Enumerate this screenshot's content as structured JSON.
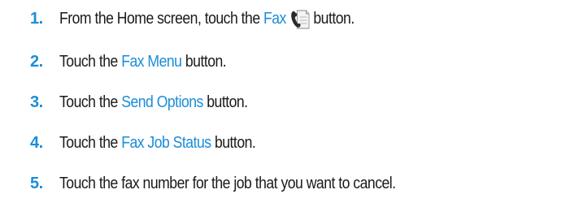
{
  "accent_color": "#1a8dd8",
  "steps": [
    {
      "number": "1.",
      "number_color": "#1a8dd8",
      "before": "From the Home screen, touch the",
      "link": "Fax",
      "icon": "fax-phone-icon",
      "after": "button."
    },
    {
      "number": "2.",
      "number_color": "#1a8dd8",
      "before": "Touch the",
      "link": "Fax Menu",
      "after": "button."
    },
    {
      "number": "3.",
      "number_color": "#1a8dd8",
      "before": "Touch the",
      "link": "Send Options",
      "after": "button."
    },
    {
      "number": "4.",
      "number_color": "#1a8dd8",
      "before": "Touch the",
      "link": "Fax Job Status",
      "after": "button."
    },
    {
      "number": "5.",
      "number_color": "#1a8dd8",
      "text": "Touch the fax number for the job that you want to cancel."
    }
  ]
}
